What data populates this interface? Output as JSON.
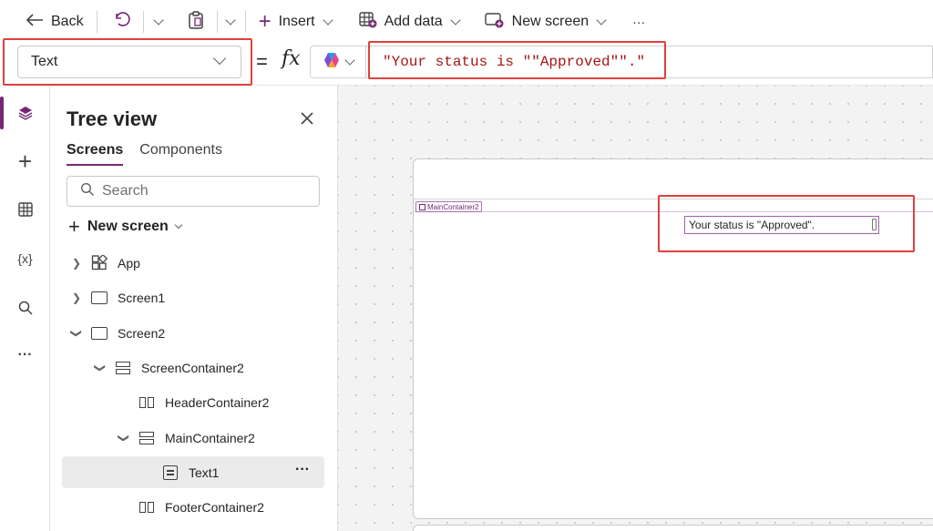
{
  "toolbar": {
    "back_label": "Back",
    "insert_label": "Insert",
    "add_data_label": "Add data",
    "new_screen_label": "New screen",
    "more_label": "···"
  },
  "formula_bar": {
    "property": "Text",
    "equals": "=",
    "fx": "fx",
    "formula": "\"Your status is \"\"Approved\"\".\""
  },
  "tree_view": {
    "title": "Tree view",
    "tabs": [
      "Screens",
      "Components"
    ],
    "active_tab": "Screens",
    "search_placeholder": "Search",
    "new_screen_label": "New screen",
    "nodes": [
      {
        "label": "App",
        "icon": "app-icon",
        "expander": "collapsed"
      },
      {
        "label": "Screen1",
        "icon": "screen-icon",
        "expander": "collapsed"
      },
      {
        "label": "Screen2",
        "icon": "screen-icon",
        "expander": "expanded"
      },
      {
        "label": "ScreenContainer2",
        "icon": "vertical-container-icon",
        "expander": "expanded"
      },
      {
        "label": "HeaderContainer2",
        "icon": "horizontal-container-icon",
        "expander": "none"
      },
      {
        "label": "MainContainer2",
        "icon": "vertical-container-icon",
        "expander": "expanded"
      },
      {
        "label": "Text1",
        "icon": "text-icon",
        "expander": "none",
        "selected": true
      },
      {
        "label": "FooterContainer2",
        "icon": "horizontal-container-icon",
        "expander": "none"
      }
    ],
    "more_label": "···"
  },
  "rail": {
    "items": [
      "tree-view-icon",
      "insert-icon",
      "data-icon",
      "variables-icon",
      "search-icon",
      "more-icon"
    ],
    "variables_label": "{x}",
    "more_label": "···"
  },
  "canvas": {
    "container_tag": "MainContainer2",
    "label_text": "Your status is \"Approved\"."
  },
  "colors": {
    "accent": "#742774",
    "highlight": "#e0403e",
    "formula_text": "#a31515"
  }
}
